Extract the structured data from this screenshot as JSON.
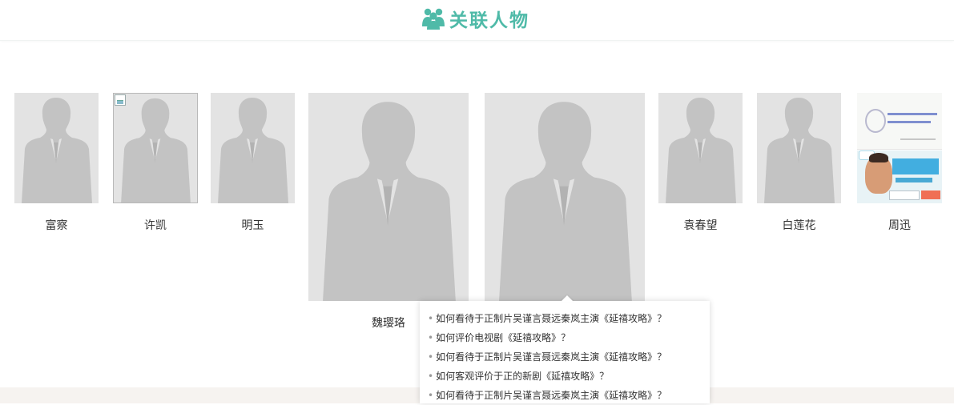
{
  "header": {
    "title": "关联人物",
    "icon": "group-icon",
    "accent_color": "#4fbaa8"
  },
  "people": [
    {
      "name": "富察",
      "photo": "silhouette"
    },
    {
      "name": "许凯",
      "photo": "silhouette-broken-image"
    },
    {
      "name": "明玉",
      "photo": "silhouette"
    },
    {
      "name": "魏璎珞",
      "photo": "silhouette"
    },
    {
      "name": "",
      "photo": "silhouette"
    },
    {
      "name": "袁春望",
      "photo": "silhouette"
    },
    {
      "name": "白莲花",
      "photo": "silhouette"
    },
    {
      "name": "周迅",
      "photo": "advertisement-image"
    }
  ],
  "popup": {
    "questions": [
      "如何看待于正制片吴谨言聂远秦岚主演《延禧攻略》？",
      "如何评价电视剧《延禧攻略》？",
      "如何看待于正制片吴谨言聂远秦岚主演《延禧攻略》？",
      "如何客观评价于正的新剧《延禧攻略》？",
      "如何看待于正制片吴谨言聂远秦岚主演《延禧攻略》？"
    ],
    "bullet": "•"
  }
}
